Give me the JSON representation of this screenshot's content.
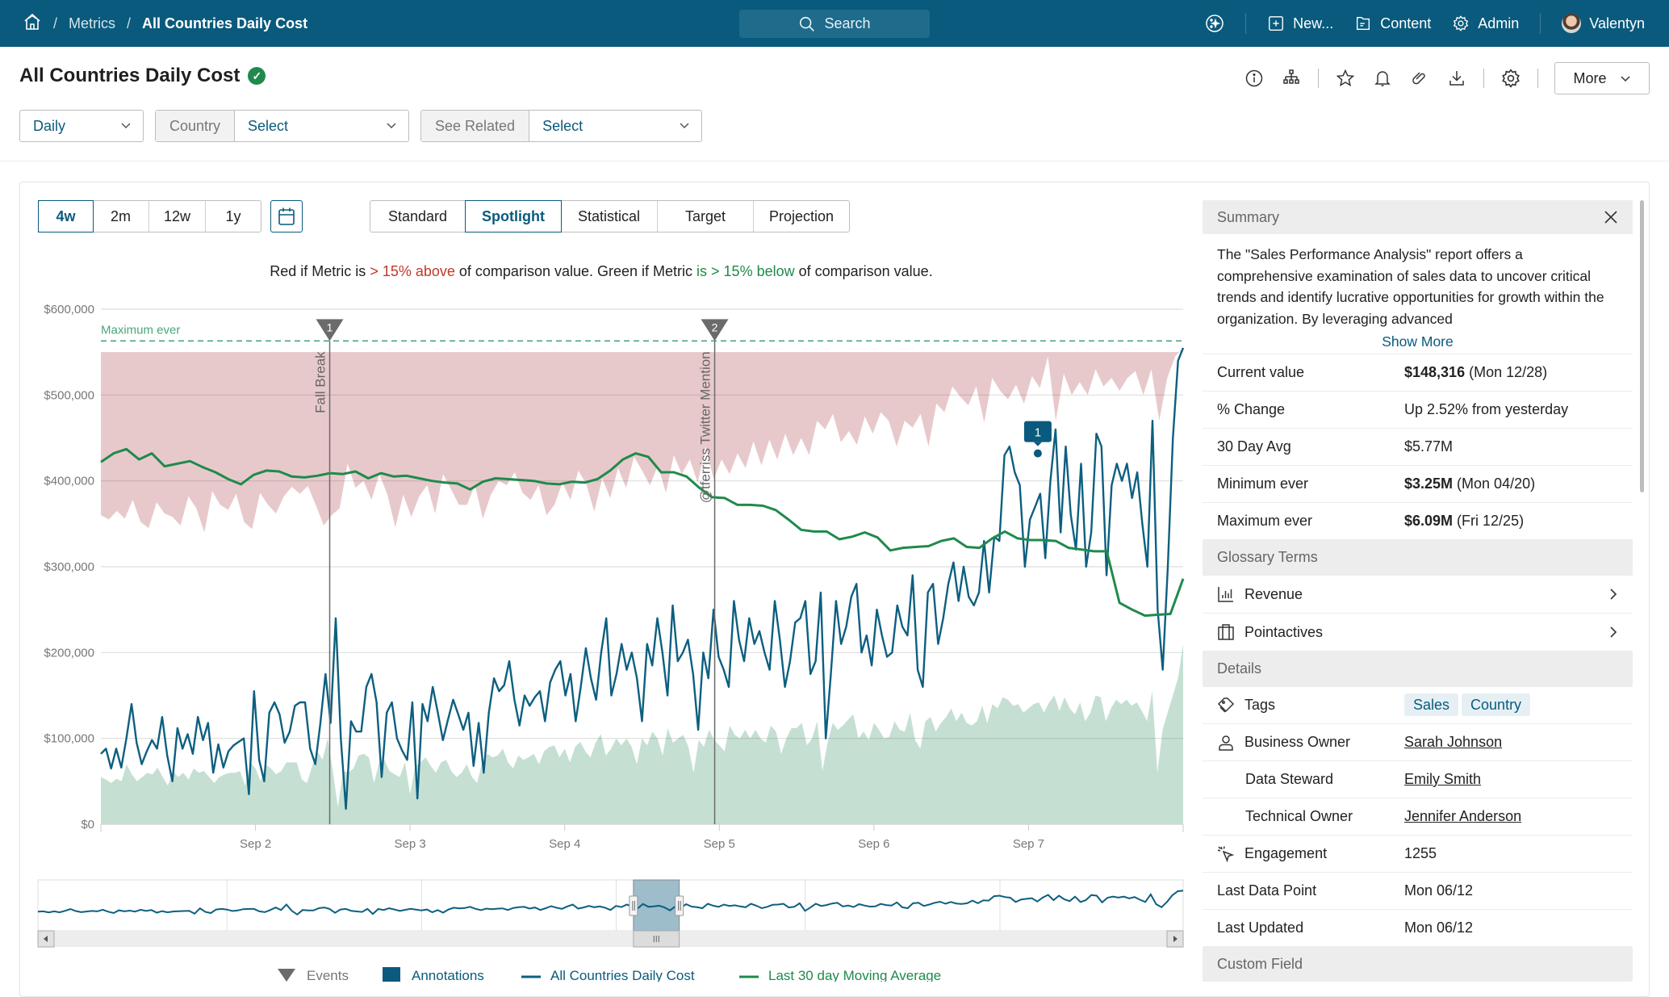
{
  "nav": {
    "breadcrumb": [
      "Metrics",
      "All Countries Daily Cost"
    ],
    "search_placeholder": "Search",
    "items": [
      {
        "icon": "sparkle-icon",
        "label": ""
      },
      {
        "icon": "plus-square-icon",
        "label": "New..."
      },
      {
        "icon": "document-icon",
        "label": "Content"
      },
      {
        "icon": "gear-icon",
        "label": "Admin"
      },
      {
        "icon": "avatar",
        "label": "Valentyn"
      }
    ]
  },
  "page": {
    "title": "All Countries Daily Cost",
    "more_label": "More"
  },
  "filters": {
    "period": "Daily",
    "country_label": "Country",
    "country_value": "Select",
    "related_label": "See Related",
    "related_value": "Select"
  },
  "range_tabs": [
    {
      "label": "4w",
      "active": true
    },
    {
      "label": "2m",
      "active": false
    },
    {
      "label": "12w",
      "active": false
    },
    {
      "label": "1y",
      "active": false
    }
  ],
  "view_tabs": [
    {
      "label": "Standard",
      "active": false
    },
    {
      "label": "Spotlight",
      "active": true
    },
    {
      "label": "Statistical",
      "active": false
    },
    {
      "label": "Target",
      "active": false
    },
    {
      "label": "Projection",
      "active": false
    }
  ],
  "rule_text": {
    "p1": "Red if Metric is ",
    "p2": "> 15% above",
    "p3": " of comparison value. Green if Metric ",
    "p4": "is > 15% below",
    "p5": " of comparison value."
  },
  "colors": {
    "brand": "#0a5a7d",
    "metric_line": "#0d5f80",
    "moving_avg": "#1f8a4c",
    "red_band": "#e8c9cb",
    "green_band": "#c5e0d3",
    "max_line": "#4aa77a",
    "event": "#6b6b6b"
  },
  "chart_data": {
    "type": "line",
    "ylabel": "",
    "xlabel": "",
    "ylim": [
      0,
      600000
    ],
    "yticks": [
      "$0",
      "$100,000",
      "$200,000",
      "$300,000",
      "$400,000",
      "$500,000",
      "$600,000"
    ],
    "xticks": [
      "Sep 2",
      "Sep 3",
      "Sep 4",
      "Sep 5",
      "Sep 6",
      "Sep 7"
    ],
    "x_range_days": [
      1.0,
      8.0
    ],
    "reference_line": {
      "label": "Maximum ever",
      "value": 563000
    },
    "events": [
      {
        "id": "1",
        "label": "Fall Break",
        "x": 2.48
      },
      {
        "id": "2",
        "label": "@tferriss Twitter Mention",
        "x": 4.97
      }
    ],
    "annotations": [
      {
        "id": "1",
        "x": 7.06,
        "value": 432000
      }
    ],
    "series": [
      {
        "name": "All Countries Daily Cost",
        "values": [
          82000,
          88000,
          65000,
          88000,
          66000,
          100000,
          140000,
          95000,
          70000,
          85000,
          98000,
          88000,
          125000,
          80000,
          50000,
          112000,
          88000,
          105000,
          82000,
          125000,
          98000,
          118000,
          60000,
          93000,
          66000,
          85000,
          92000,
          96000,
          100000,
          35000,
          155000,
          75000,
          50000,
          130000,
          142000,
          128000,
          95000,
          108000,
          138000,
          142000,
          142000,
          88000,
          70000,
          118000,
          175000,
          118000,
          240000,
          100000,
          18000,
          120000,
          108000,
          108000,
          160000,
          175000,
          142000,
          55000,
          130000,
          142000,
          100000,
          86000,
          75000,
          142000,
          30000,
          140000,
          120000,
          160000,
          130000,
          98000,
          122000,
          145000,
          128000,
          110000,
          130000,
          68000,
          118000,
          60000,
          130000,
          170000,
          155000,
          162000,
          190000,
          145000,
          115000,
          150000,
          138000,
          148000,
          155000,
          120000,
          165000,
          180000,
          190000,
          150000,
          175000,
          120000,
          160000,
          205000,
          170000,
          145000,
          200000,
          240000,
          150000,
          175000,
          210000,
          180000,
          200000,
          170000,
          120000,
          210000,
          185000,
          240000,
          200000,
          150000,
          255000,
          190000,
          200000,
          215000,
          175000,
          110000,
          200000,
          170000,
          250000,
          195000,
          180000,
          160000,
          260000,
          215000,
          190000,
          240000,
          210000,
          225000,
          200000,
          180000,
          260000,
          215000,
          160000,
          190000,
          235000,
          240000,
          260000,
          175000,
          190000,
          270000,
          100000,
          175000,
          260000,
          210000,
          230000,
          265000,
          280000,
          200000,
          220000,
          185000,
          250000,
          220000,
          195000,
          200000,
          255000,
          230000,
          220000,
          290000,
          180000,
          160000,
          270000,
          280000,
          210000,
          240000,
          280000,
          305000,
          260000,
          300000,
          265000,
          255000,
          270000,
          330000,
          270000,
          335000,
          330000,
          430000,
          440000,
          410000,
          395000,
          300000,
          355000,
          370000,
          385000,
          310000,
          400000,
          460000,
          340000,
          440000,
          360000,
          320000,
          420000,
          300000,
          340000,
          455000,
          440000,
          290000,
          395000,
          420000,
          400000,
          420000,
          380000,
          410000,
          350000,
          300000,
          470000,
          250000,
          180000,
          300000,
          450000,
          540000,
          555000
        ],
        "color": "#0d5f80"
      },
      {
        "name": "Last 30 day Moving Average",
        "values": [
          422000,
          432000,
          437000,
          425000,
          432000,
          417000,
          420000,
          423000,
          416000,
          410000,
          402000,
          396000,
          407000,
          412000,
          411000,
          405000,
          404000,
          406000,
          409000,
          408000,
          411000,
          403000,
          409000,
          405000,
          406000,
          403000,
          400000,
          398000,
          397000,
          390000,
          399000,
          403000,
          402000,
          401000,
          400000,
          397000,
          396000,
          399000,
          398000,
          402000,
          412000,
          425000,
          432000,
          428000,
          410000,
          410000,
          405000,
          392000,
          381000,
          380000,
          372000,
          372000,
          371000,
          366000,
          355000,
          343000,
          341000,
          341000,
          332000,
          335000,
          340000,
          334000,
          319000,
          322000,
          323000,
          324000,
          330000,
          333000,
          323000,
          322000,
          333000,
          341000,
          333000,
          331000,
          331000,
          330000,
          322000,
          320000,
          318000,
          318000,
          258000,
          250000,
          243000,
          244000,
          245000,
          286000
        ],
        "color": "#1f8a4c"
      }
    ],
    "red_band_lower": [
      360000,
      355000,
      365000,
      356000,
      378000,
      352000,
      345000,
      375000,
      362000,
      358000,
      348000,
      382000,
      368000,
      340000,
      388000,
      372000,
      366000,
      385000,
      352000,
      344000,
      386000,
      372000,
      362000,
      382000,
      393000,
      385000,
      394000,
      372000,
      348000,
      360000,
      368000,
      420000,
      392000,
      400000,
      378000,
      408000,
      384000,
      346000,
      384000,
      358000,
      382000,
      395000,
      362000,
      408000,
      390000,
      372000,
      372000,
      395000,
      356000,
      384000,
      400000,
      395000,
      410000,
      386000,
      378000,
      395000,
      360000,
      372000,
      398000,
      378000,
      412000,
      396000,
      364000,
      403000,
      380000,
      415000,
      392000,
      428000,
      412000,
      395000,
      418000,
      386000,
      430000,
      408000,
      425000,
      398000,
      440000,
      402000,
      425000,
      408000,
      432000,
      415000,
      446000,
      418000,
      448000,
      425000,
      455000,
      430000,
      450000,
      430000,
      470000,
      460000,
      478000,
      445000,
      458000,
      442000,
      475000,
      455000,
      480000,
      470000,
      440000,
      470000,
      462000,
      478000,
      440000,
      490000,
      480000,
      510000,
      498000,
      488000,
      510000,
      468000,
      520000,
      505000,
      495000,
      512000,
      490000,
      522000,
      508000,
      545000,
      470000,
      525000,
      500000,
      515000,
      500000,
      530000,
      510000,
      520000,
      505000,
      520000,
      528000,
      500000,
      530000,
      470000,
      520000,
      545000,
      555000
    ],
    "red_band_upper": 550000,
    "green_band_upper": [
      55000,
      52000,
      48000,
      53000,
      50000,
      70000,
      58000,
      50000,
      55000,
      60000,
      58000,
      66000,
      55000,
      45000,
      62000,
      55000,
      60000,
      52000,
      65000,
      60000,
      62000,
      55000,
      48000,
      55000,
      58000,
      60000,
      60000,
      62000,
      45000,
      72000,
      65000,
      50000,
      70000,
      65000,
      58000,
      62000,
      72000,
      72000,
      72000,
      52000,
      48000,
      68000,
      85000,
      75000,
      100000,
      62000,
      20000,
      62000,
      60000,
      65000,
      80000,
      82000,
      78000,
      48000,
      72000,
      75000,
      62000,
      58000,
      55000,
      72000,
      35000,
      68000,
      72000,
      78000,
      68000,
      60000,
      72000,
      75000,
      62000,
      55000,
      60000,
      70000,
      55000,
      48000,
      72000,
      82000,
      78000,
      80000,
      88000,
      72000,
      65000,
      80000,
      75000,
      78000,
      82000,
      70000,
      85000,
      90000,
      92000,
      78000,
      88000,
      72000,
      90000,
      96000,
      85000,
      78000,
      95000,
      105000,
      80000,
      88000,
      100000,
      92000,
      100000,
      90000,
      70000,
      100000,
      92000,
      108000,
      100000,
      80000,
      112000,
      95000,
      100000,
      104000,
      90000,
      60000,
      98000,
      90000,
      110000,
      98000,
      92000,
      85000,
      115000,
      104000,
      100000,
      110000,
      100000,
      110000,
      100000,
      95000,
      115000,
      108000,
      82000,
      100000,
      112000,
      112000,
      118000,
      92000,
      100000,
      120000,
      62000,
      95000,
      118000,
      110000,
      115000,
      122000,
      128000,
      100000,
      108000,
      98000,
      118000,
      110000,
      100000,
      102000,
      120000,
      110000,
      108000,
      130000,
      98000,
      88000,
      120000,
      125000,
      108000,
      118000,
      125000,
      135000,
      120000,
      130000,
      118000,
      115000,
      120000,
      138000,
      118000,
      140000,
      135000,
      148000,
      145000,
      138000,
      140000,
      130000,
      135000,
      140000,
      142000,
      130000,
      142000,
      150000,
      132000,
      148000,
      135000,
      128000,
      142000,
      120000,
      130000,
      150000,
      148000,
      120000,
      135000,
      145000,
      140000,
      145000,
      138000,
      142000,
      132000,
      120000,
      155000,
      60000,
      110000,
      130000,
      150000,
      170000,
      210000
    ],
    "navigator": {
      "selected_range_fraction": [
        0.52,
        0.56
      ]
    },
    "legend": [
      "Events",
      "Annotations",
      "All Countries Daily Cost",
      "Last 30 day Moving Average"
    ],
    "legend_position": "bottom"
  },
  "panel": {
    "summary_header": "Summary",
    "summary_text": "The \"Sales Performance Analysis\" report offers a comprehensive examination of sales data to uncover critical trends and identify lucrative opportunities for growth within the organization. By leveraging advanced",
    "show_more": "Show More",
    "stats": [
      {
        "label": "Current value",
        "bold": "$148,316",
        "rest": " (Mon 12/28)"
      },
      {
        "label": "% Change",
        "bold": "",
        "rest": "Up 2.52% from yesterday"
      },
      {
        "label": "30 Day Avg",
        "bold": "",
        "rest": "$5.77M"
      },
      {
        "label": "Minimum ever",
        "bold": "$3.25M",
        "rest": " (Mon 04/20)"
      },
      {
        "label": "Maximum ever",
        "bold": "$6.09M",
        "rest": " (Fri 12/25)"
      }
    ],
    "glossary_header": "Glossary Terms",
    "glossary": [
      {
        "icon": "bar-chart-icon",
        "label": "Revenue"
      },
      {
        "icon": "briefcase-icon",
        "label": "Pointactives"
      }
    ],
    "details_header": "Details",
    "tags_label": "Tags",
    "tags": [
      "Sales",
      "Country"
    ],
    "business_owner_label": "Business Owner",
    "business_owner": "Sarah Johnson",
    "data_steward_label": "Data Steward",
    "data_steward": "Emily Smith",
    "technical_owner_label": "Technical Owner",
    "technical_owner": "Jennifer Anderson",
    "engagement_label": "Engagement",
    "engagement": "1255",
    "last_data_point_label": "Last Data Point",
    "last_data_point": "Mon 06/12",
    "last_updated_label": "Last Updated",
    "last_updated": "Mon 06/12",
    "custom_field_header": "Custom Field"
  }
}
